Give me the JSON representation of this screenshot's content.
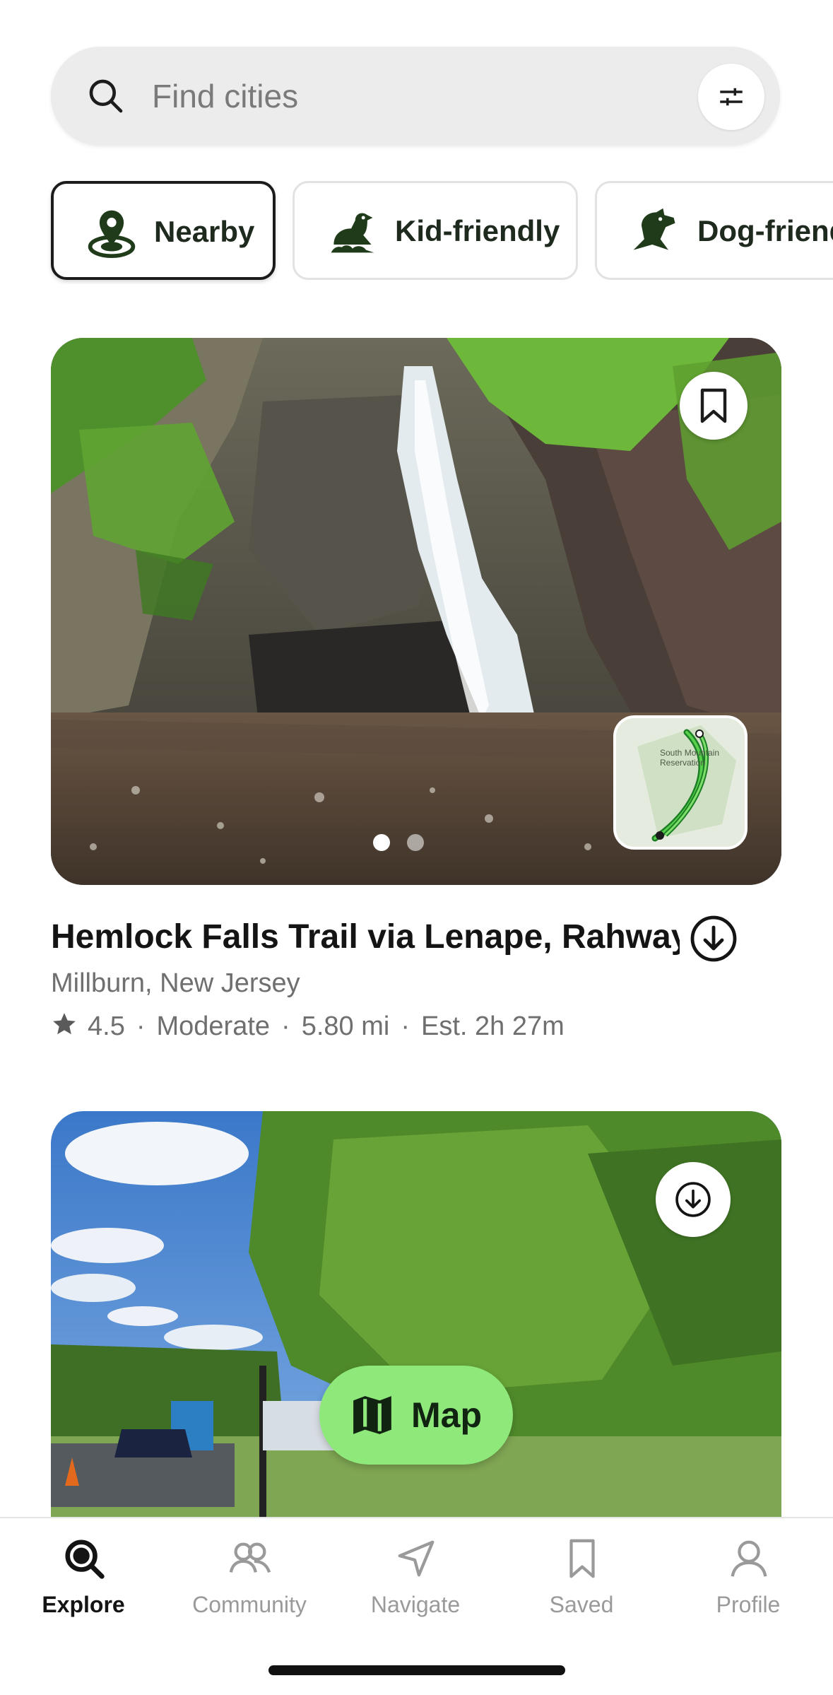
{
  "search": {
    "placeholder": "Find cities"
  },
  "chips": [
    {
      "label": "Nearby",
      "active": true,
      "icon": "location-pin-icon"
    },
    {
      "label": "Kid-friendly",
      "active": false,
      "icon": "kid-friendly-icon"
    },
    {
      "label": "Dog-friendly",
      "active": false,
      "icon": "dog-icon"
    }
  ],
  "trail": {
    "title": "Hemlock Falls Trail via Lenape, Rahway,...",
    "location": "Millburn, New Jersey",
    "rating": "4.5",
    "difficulty": "Moderate",
    "distance": "5.80 mi",
    "est_time": "Est. 2h 27m",
    "separator": "·",
    "minimap_label": "South Mountain Reservation",
    "photo_count": 2,
    "current_photo": 1
  },
  "map_button": {
    "label": "Map"
  },
  "tabs": [
    {
      "label": "Explore",
      "active": true,
      "icon": "explore-search-icon"
    },
    {
      "label": "Community",
      "active": false,
      "icon": "community-icon"
    },
    {
      "label": "Navigate",
      "active": false,
      "icon": "navigate-arrow-icon"
    },
    {
      "label": "Saved",
      "active": false,
      "icon": "bookmark-icon"
    },
    {
      "label": "Profile",
      "active": false,
      "icon": "profile-icon"
    }
  ],
  "colors": {
    "accent_green": "#8ee87a",
    "dark_green": "#1f3b1a",
    "text_dark": "#141414",
    "text_muted": "#6f6f6f"
  }
}
